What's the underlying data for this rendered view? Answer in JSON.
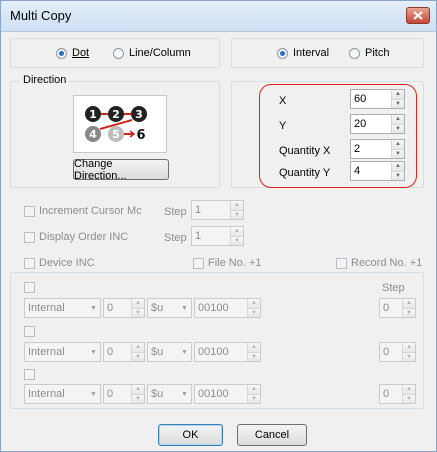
{
  "window": {
    "title": "Multi Copy"
  },
  "mode": {
    "options": [
      {
        "label": "Dot",
        "selected": true
      },
      {
        "label": "Line/Column",
        "selected": false
      }
    ]
  },
  "spacing": {
    "options": [
      {
        "label": "Interval",
        "selected": true
      },
      {
        "label": "Pitch",
        "selected": false
      }
    ]
  },
  "direction": {
    "label": "Direction",
    "order_glyphs": [
      "1",
      "2",
      "3",
      "4",
      "5",
      "6"
    ],
    "change_button": "Change Direction..."
  },
  "params": {
    "x_label": "X",
    "x_value": "60",
    "y_label": "Y",
    "y_value": "20",
    "qx_label": "Quantity X",
    "qx_value": "2",
    "qy_label": "Quantity Y",
    "qy_value": "4"
  },
  "increment_cursor": {
    "label": "Increment Cursor Mc",
    "step_label": "Step",
    "step_value": "1"
  },
  "display_order": {
    "label": "Display Order INC",
    "step_label": "Step",
    "step_value": "1"
  },
  "device_inc": {
    "label": "Device INC"
  },
  "file_no": {
    "label": "File No. +1"
  },
  "record_no": {
    "label": "Record No. +1"
  },
  "device_rows": {
    "step_header": "Step",
    "rows": [
      {
        "memory": "Internal",
        "index": "0",
        "type": "$u",
        "address": "00100",
        "step": "0"
      },
      {
        "memory": "Internal",
        "index": "0",
        "type": "$u",
        "address": "00100",
        "step": "0"
      },
      {
        "memory": "Internal",
        "index": "0",
        "type": "$u",
        "address": "00100",
        "step": "0"
      }
    ]
  },
  "footer": {
    "ok": "OK",
    "cancel": "Cancel"
  },
  "colors": {
    "highlight": "#e0241b",
    "accent": "#3c7fb1",
    "close": "#c4473a"
  }
}
